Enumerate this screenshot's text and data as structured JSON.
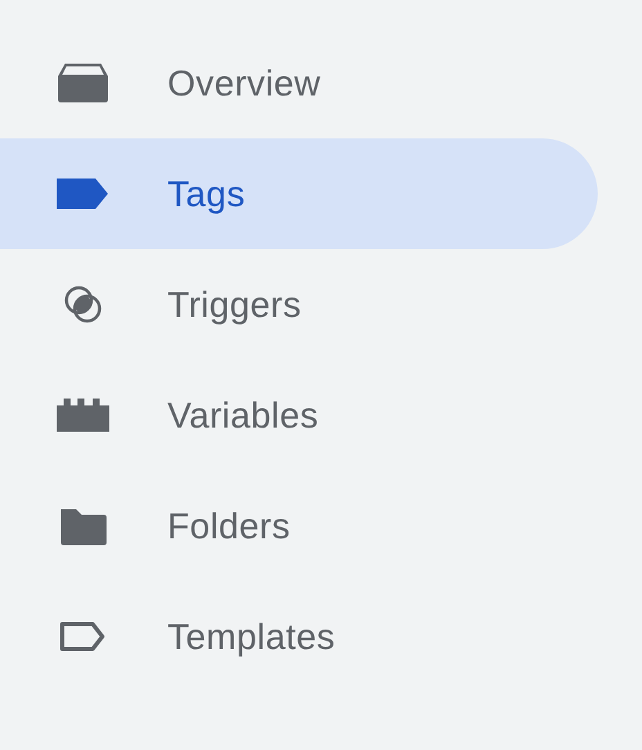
{
  "nav": [
    {
      "label": "Overview",
      "kind": "overview",
      "selected": false
    },
    {
      "label": "Tags",
      "kind": "tags",
      "selected": true
    },
    {
      "label": "Triggers",
      "kind": "triggers",
      "selected": false
    },
    {
      "label": "Variables",
      "kind": "variables",
      "selected": false
    },
    {
      "label": "Folders",
      "kind": "folders",
      "selected": false
    },
    {
      "label": "Templates",
      "kind": "templates",
      "selected": false
    }
  ]
}
